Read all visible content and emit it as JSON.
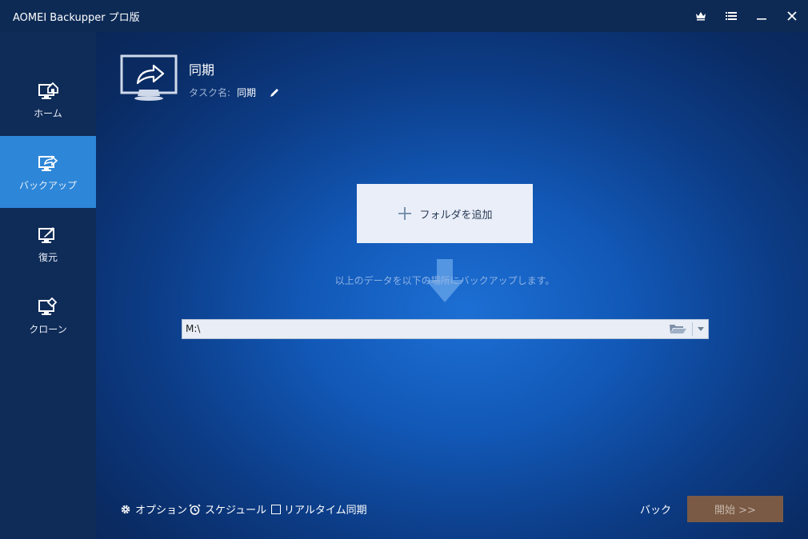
{
  "window": {
    "title": "AOMEI Backupper プロ版",
    "controls": [
      "crown-icon",
      "menu-icon",
      "minimize-icon",
      "close-icon"
    ]
  },
  "sidebar": {
    "items": [
      {
        "label": "ホーム",
        "icon": "home-monitor-icon",
        "active": false
      },
      {
        "label": "バックアップ",
        "icon": "backup-monitor-icon",
        "active": true
      },
      {
        "label": "復元",
        "icon": "restore-monitor-icon",
        "active": false
      },
      {
        "label": "クローン",
        "icon": "clone-monitor-icon",
        "active": false
      }
    ]
  },
  "operation": {
    "title": "同期",
    "task_label": "タスク名:",
    "task_name": "同期",
    "icon": "sync-monitor-icon"
  },
  "source": {
    "add_folder_label": "フォルダを追加"
  },
  "hint_text": "以上のデータを以下の場所にバックアップします。",
  "destination": {
    "value": "M:\\"
  },
  "footer": {
    "options_label": "オプション",
    "schedule_label": "スケジュール",
    "realtime_label": "リアルタイム同期",
    "realtime_checked": false,
    "back_label": "バック",
    "start_label": "開始 >>"
  },
  "colors": {
    "sidebar_bg": "#0f2b57",
    "active_nav": "#2d86d8",
    "start_button": "#7a5a44"
  }
}
